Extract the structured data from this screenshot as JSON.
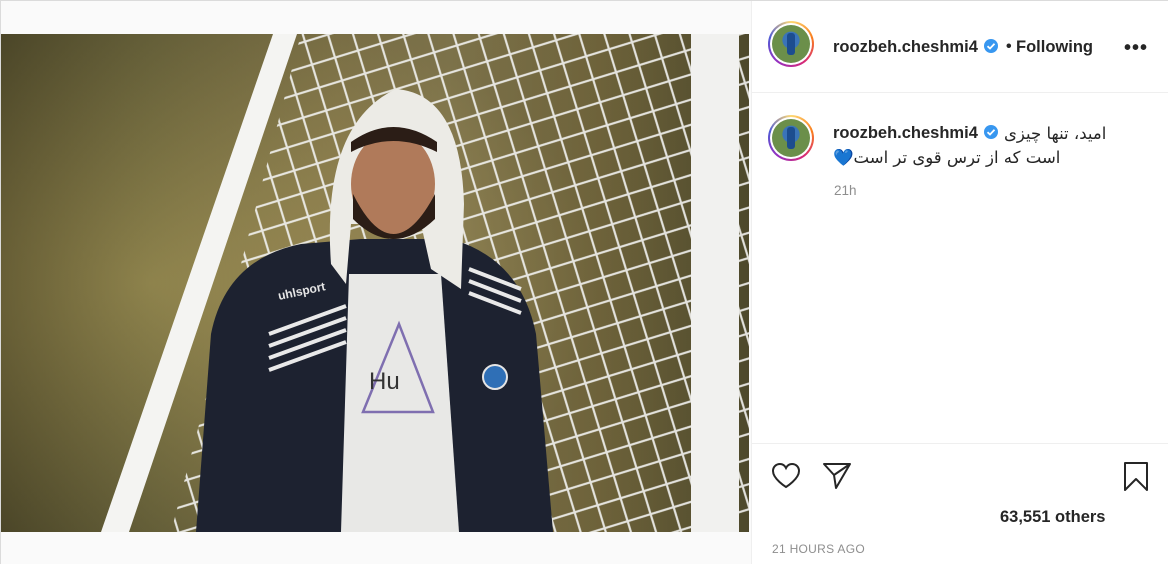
{
  "post": {
    "username": "roozbeh.cheshmi4",
    "follow_separator": "•",
    "follow_status": "Following",
    "more_label": "•••",
    "caption_line1": "امید، تنها چیزی",
    "caption_line2": "است که از ترس قوی تر است",
    "caption_emoji": "💙",
    "comment_time": "21h",
    "likes_text": "63,551 others",
    "posted_ago": "21 HOURS AGO"
  },
  "icons": {
    "verified": "verified-badge-icon",
    "like": "heart-outline-icon",
    "share": "paper-plane-icon",
    "save": "bookmark-icon",
    "more": "more-options-icon"
  },
  "photo": {
    "shirt_text": "Hu",
    "jacket_brand": "uhlsport"
  },
  "colors": {
    "verified": "#3897f0",
    "text": "#262626",
    "muted": "#8e8e8e",
    "emoji_heart": "#29a9e1"
  }
}
